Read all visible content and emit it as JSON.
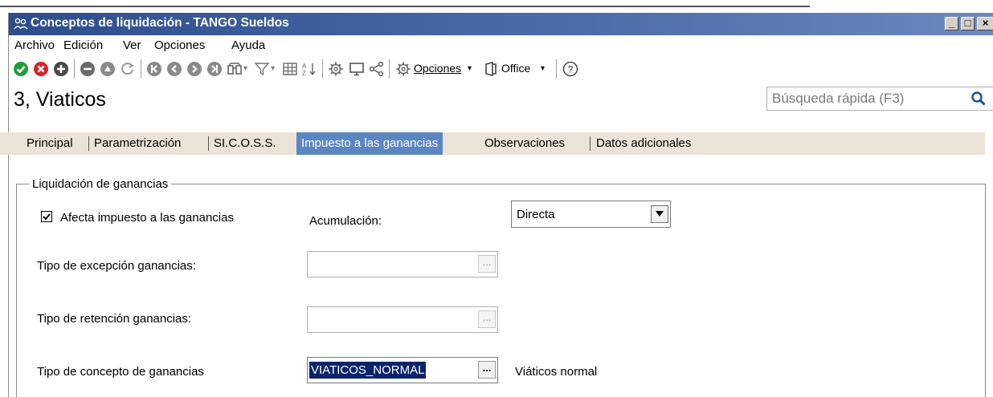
{
  "window": {
    "title": "Conceptos de liquidación - TANGO Sueldos",
    "controls": [
      "minimize",
      "maximize",
      "close"
    ]
  },
  "menu": {
    "items": [
      "Archivo",
      "Edición",
      "Ver",
      "Opciones",
      "Ayuda"
    ]
  },
  "toolbar": {
    "icons": [
      "accept-icon",
      "cancel-icon",
      "add-icon",
      "remove-icon",
      "edit-icon",
      "refresh-icon",
      "first-icon",
      "previous-icon",
      "next-icon",
      "last-icon",
      "binoculars-icon",
      "filter-icon",
      "grid-icon",
      "sort-icon",
      "gear-icon",
      "monitor-icon",
      "share-icon"
    ],
    "opciones_label": "Opciones",
    "office_label": "Office",
    "help_label": "?"
  },
  "record": {
    "title": "3, Viaticos"
  },
  "search": {
    "placeholder": "Búsqueda rápida (F3)"
  },
  "tabs": [
    {
      "label": "Principal",
      "active": false
    },
    {
      "label": "Parametrización",
      "active": false
    },
    {
      "label": "SI.C.O.S.S.",
      "active": false
    },
    {
      "label": "Impuesto a las ganancias",
      "active": true
    },
    {
      "label": "Observaciones",
      "active": false
    },
    {
      "label": "Datos adicionales",
      "active": false
    }
  ],
  "form": {
    "group_title": "Liquidación de ganancias",
    "afecta_label": "Afecta impuesto a las ganancias",
    "afecta_checked": true,
    "acumulacion_label": "Acumulación:",
    "acumulacion_value": "Directa",
    "excepcion_label": "Tipo de excepción ganancias:",
    "excepcion_value": "",
    "retencion_label": "Tipo de retención ganancias:",
    "retencion_value": "",
    "concepto_label": "Tipo de concepto de ganancias",
    "concepto_value": "VIATICOS_NORMAL",
    "concepto_desc": "Viáticos normal",
    "ellipsis": "..."
  },
  "colors": {
    "titlebar": "#2d4d8c",
    "active_tab": "#5b86c1",
    "tab_strip": "#ece3d8",
    "selection": "#0a246a"
  }
}
